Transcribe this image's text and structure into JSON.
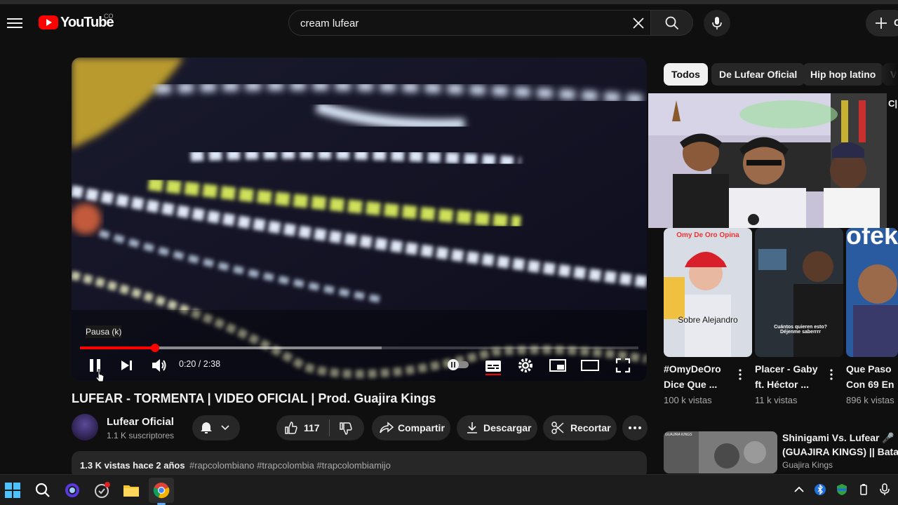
{
  "masthead": {
    "logo_text": "YouTube",
    "country_code": "CO",
    "search_value": "cream lufear",
    "create_label": "C"
  },
  "player": {
    "tooltip": "Pausa (k)",
    "time": "0:20 / 2:38",
    "progress_played": 0.135,
    "progress_buffered": 0.54
  },
  "video": {
    "title": "LUFEAR - TORMENTA | VIDEO OFICIAL | Prod. Guajira Kings",
    "channel": "Lufear Oficial",
    "subscribers": "1.1 K suscriptores",
    "likes": "117",
    "share_label": "Compartir",
    "download_label": "Descargar",
    "clip_label": "Recortar",
    "views_date": "1.3 K vistas  hace 2 años",
    "hashtags": [
      "#rapcolombiano",
      "#trapcolombia",
      "#trapcolombiamijo"
    ]
  },
  "sidebar": {
    "chips": [
      "Todos",
      "De Lufear Oficial",
      "Hip hop latino",
      "V"
    ],
    "overlay_edge_text": "C|",
    "shorts": [
      {
        "overlay_top": "Omy De Oro Opina",
        "overlay_caption": "Sobre Alejandro",
        "title_line1": "#OmyDeOro",
        "title_line2": "Dice Que ...",
        "views": "100 k vistas"
      },
      {
        "overlay_caption": "Cuántos quieren esto? Déjenme saberrrr",
        "title_line1": "Placer - Gaby",
        "title_line2": "ft. Héctor ...",
        "views": "11 k vistas"
      },
      {
        "overlay_top": "ofek",
        "title_line1": "Que Paso",
        "title_line2": "Con 69 En",
        "views": "896 k vistas"
      }
    ],
    "recommended": {
      "thumb_text": "GUAJIRA KINGS",
      "title_line1": "Shinigami Vs. Lufear 🎤",
      "title_line2": "(GUAJIRA KINGS) || Batalla",
      "channel": "Guajira Kings"
    }
  },
  "colors": {
    "background": "#0f0f0f",
    "accent_red": "#ff0000",
    "link_blue": "#3ea6ff",
    "pill": "#272727"
  }
}
